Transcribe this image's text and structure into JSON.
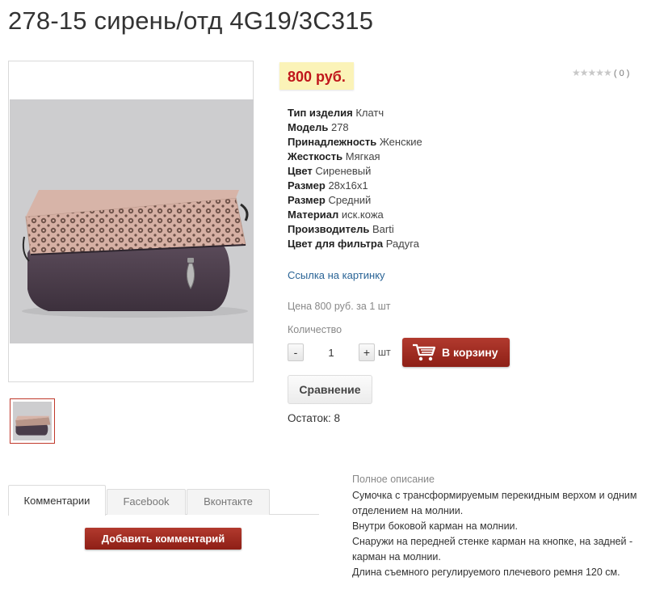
{
  "product": {
    "title": "278-15 сирень/отд 4G19/3C315",
    "price": "800 руб.",
    "rating_count": "( 0 )",
    "rating_stars": 0
  },
  "properties": [
    {
      "key": "Тип изделия",
      "value": "Клатч"
    },
    {
      "key": "Модель",
      "value": "278"
    },
    {
      "key": "Принадлежность",
      "value": "Женские"
    },
    {
      "key": "Жесткость",
      "value": "Мягкая"
    },
    {
      "key": "Цвет",
      "value": "Сиреневый"
    },
    {
      "key": "Размер",
      "value": "28x16x1"
    },
    {
      "key": "Размер",
      "value": "Средний"
    },
    {
      "key": "Материал",
      "value": "иск.кожа"
    },
    {
      "key": "Производитель",
      "value": "Barti"
    },
    {
      "key": "Цвет для фильтра",
      "value": "Радуга"
    }
  ],
  "links": {
    "image_link": "Ссылка на картинку"
  },
  "purchase": {
    "price_line": "Цена 800 руб. за 1 шт",
    "qty_label": "Количество",
    "minus": "-",
    "quantity": "1",
    "plus": "+",
    "unit": "шт",
    "cart_label": "В корзину",
    "compare_label": "Сравнение",
    "stock": "Остаток: 8"
  },
  "tabs": [
    {
      "label": "Комментарии",
      "active": true
    },
    {
      "label": "Facebook",
      "active": false
    },
    {
      "label": "Вконтакте",
      "active": false
    }
  ],
  "comments": {
    "add_label": "Добавить комментарий"
  },
  "description": {
    "title": "Полное описание",
    "lines": [
      "Сумочка с трансформируемым перекидным верхом и одним",
      "отделением на молнии.",
      "Внутри боковой карман на молнии.",
      "Снаружи на передней стенке карман на кнопке, на задней -",
      "карман на молнии.",
      "Длина съемного регулируемого плечевого ремня 120 см."
    ]
  },
  "colors": {
    "accent_red": "#9e2a20",
    "price_bg": "#fbf3b8",
    "price_text": "#c0161b",
    "link": "#2a6496"
  },
  "icons": {
    "cart": "shopping-cart-icon",
    "stars": "rating-star-icon"
  }
}
